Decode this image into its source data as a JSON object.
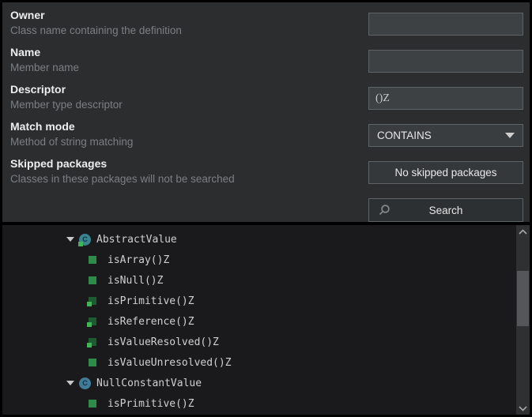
{
  "form": {
    "rows": [
      {
        "label": "Owner",
        "description": "Class name containing the definition",
        "value": "",
        "type": "text"
      },
      {
        "label": "Name",
        "description": "Member name",
        "value": "",
        "type": "text"
      },
      {
        "label": "Descriptor",
        "description": "Member type descriptor",
        "value": "()Z",
        "type": "text"
      },
      {
        "label": "Match mode",
        "description": "Method of string matching",
        "value": "CONTAINS",
        "type": "select"
      },
      {
        "label": "Skipped packages",
        "description": "Classes in these packages will not be searched",
        "value": "No skipped packages",
        "type": "button"
      }
    ],
    "search_button": "Search"
  },
  "tree": {
    "items": [
      {
        "label": "AbstractValue",
        "kind": "class",
        "variant": "abstract",
        "expanded": true
      },
      {
        "label": "isArray()Z",
        "kind": "method",
        "variant": "plain"
      },
      {
        "label": "isNull()Z",
        "kind": "method",
        "variant": "plain"
      },
      {
        "label": "isPrimitive()Z",
        "kind": "method",
        "variant": "overlay"
      },
      {
        "label": "isReference()Z",
        "kind": "method",
        "variant": "overlay"
      },
      {
        "label": "isValueResolved()Z",
        "kind": "method",
        "variant": "overlay"
      },
      {
        "label": "isValueUnresolved()Z",
        "kind": "method",
        "variant": "plain"
      },
      {
        "label": "NullConstantValue",
        "kind": "class",
        "variant": "plain",
        "expanded": true
      },
      {
        "label": "isPrimitive()Z",
        "kind": "method",
        "variant": "plain"
      }
    ]
  },
  "icons": {
    "class_glyph": "C",
    "expander_expanded": "triangle-down",
    "combo_caret": "triangle-down",
    "search": "magnifier",
    "scroll_up": "chevron-up",
    "scroll_down": "chevron-down"
  },
  "colors": {
    "form_bg": "#2b2d2f",
    "tree_bg": "#1a1a1d",
    "input_bg": "#3e4144",
    "control_border": "#5e6365",
    "label_text": "#eeeeee",
    "description_text": "#7c7f82",
    "tree_text": "#d0d0d0",
    "class_icon_blue": "#427b98",
    "class_icon_teal": "#3a8390",
    "method_green": "#2e8b4a",
    "method_dark_green": "#1d5c31",
    "overlay_green": "#41b455",
    "scroll_thumb": "#53575a"
  }
}
